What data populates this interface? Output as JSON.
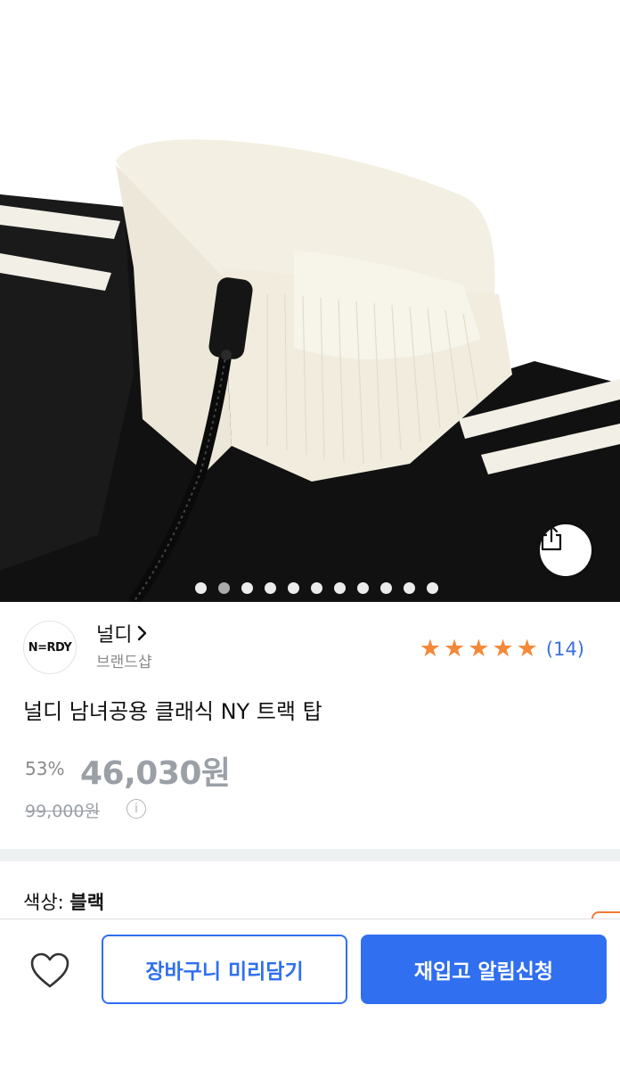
{
  "gallery": {
    "total_images": 11,
    "active_index": 1,
    "share_icon": "share-icon"
  },
  "brand": {
    "logo_text": "N=RDY",
    "name": "널디",
    "chevron": "chevron-right-icon",
    "subtitle": "브랜드샵"
  },
  "rating": {
    "stars": 5,
    "max_stars": 5,
    "review_count": "(14)"
  },
  "product": {
    "title": "널디 남녀공용 클래식 NY 트랙 탑",
    "discount": "53%",
    "price": "46,030원",
    "original_price": "99,000원",
    "info_icon": "info-icon"
  },
  "options": {
    "label": "색상:",
    "value": "블랙"
  },
  "bottom_bar": {
    "wishlist_icon": "heart-icon",
    "cart_button": "장바구니 미리담기",
    "restock_button": "재입고 알림신청"
  },
  "colors": {
    "accent_blue": "#2f6ff0",
    "star_orange": "#f5893a",
    "price_gray": "#9aa0a6"
  }
}
